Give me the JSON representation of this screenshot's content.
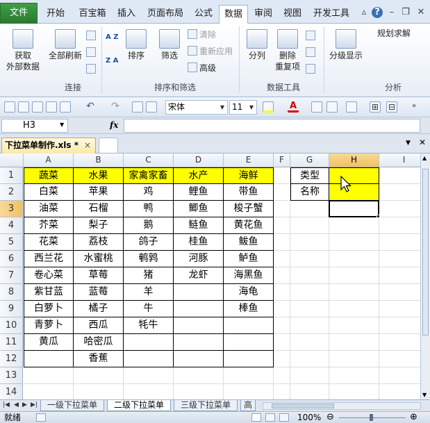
{
  "ribbon_tabs": [
    {
      "label": "文件",
      "key": "file"
    },
    {
      "label": "开始",
      "key": "home"
    },
    {
      "label": "百宝箱",
      "key": "toolbox"
    },
    {
      "label": "插入",
      "key": "insert"
    },
    {
      "label": "页面布局",
      "key": "layout"
    },
    {
      "label": "公式",
      "key": "formulas"
    },
    {
      "label": "数据",
      "key": "data"
    },
    {
      "label": "审阅",
      "key": "review"
    },
    {
      "label": "视图",
      "key": "view"
    },
    {
      "label": "开发工具",
      "key": "developer"
    }
  ],
  "ribbon": {
    "get_external": [
      "获取",
      "外部数据"
    ],
    "refresh_all": "全部刷新",
    "group_connections": "连接",
    "sort": "排序",
    "filter": "筛选",
    "clear": "清除",
    "reapply": "重新应用",
    "advanced": "高级",
    "group_sort_filter": "排序和筛选",
    "text_to_columns": "分列",
    "remove_duplicates": [
      "删除",
      "重复项"
    ],
    "group_data_tools": "数据工具",
    "outline": "分级显示",
    "solver": "规划求解",
    "group_analysis": "分析",
    "sort_az": "A Z",
    "sort_za": "Z A"
  },
  "toolbar": {
    "font_name": "宋体",
    "font_size": "11"
  },
  "formula_bar": {
    "name_box": "H3",
    "fx": "fx",
    "formula": ""
  },
  "doc_tab": {
    "title": "下拉菜单制作.xls *",
    "close": "×"
  },
  "columns": [
    "A",
    "B",
    "C",
    "D",
    "E",
    "F",
    "G",
    "H",
    "I"
  ],
  "rows": [
    "1",
    "2",
    "3",
    "4",
    "5",
    "6",
    "7",
    "8",
    "9",
    "10",
    "11",
    "12",
    "13",
    "14"
  ],
  "table": {
    "headers": [
      "蔬菜",
      "水果",
      "家禽家畜",
      "水产",
      "海鲜"
    ],
    "rows": [
      [
        "白菜",
        "苹果",
        "鸡",
        "鲤鱼",
        "带鱼"
      ],
      [
        "油菜",
        "石榴",
        "鸭",
        "鲫鱼",
        "梭子蟹"
      ],
      [
        "芥菜",
        "梨子",
        "鹅",
        "鲢鱼",
        "黄花鱼"
      ],
      [
        "花菜",
        "荔枝",
        "鸽子",
        "桂鱼",
        "鲅鱼"
      ],
      [
        "西兰花",
        "水蜜桃",
        "鹌鹑",
        "河豚",
        "鲈鱼"
      ],
      [
        "卷心菜",
        "草莓",
        "猪",
        "龙虾",
        "海黑鱼"
      ],
      [
        "紫甘蓝",
        "蓝莓",
        "羊",
        "",
        "海龟"
      ],
      [
        "白萝卜",
        "橘子",
        "牛",
        "",
        "棒鱼"
      ],
      [
        "青萝卜",
        "西瓜",
        "牦牛",
        "",
        ""
      ],
      [
        "黄瓜",
        "哈密瓜",
        "",
        "",
        ""
      ],
      [
        "",
        "香蕉",
        "",
        "",
        ""
      ]
    ]
  },
  "lookup": {
    "type_label": "类型",
    "name_label": "名称",
    "type_value": "",
    "name_value": ""
  },
  "sheet_tabs": [
    "一级下拉菜单",
    "二级下拉菜单",
    "三级下拉菜单",
    "高"
  ],
  "active_sheet_index": 1,
  "status": {
    "ready": "就绪",
    "zoom": "100%"
  },
  "colors": {
    "header_fill": "#ffff00",
    "file_tab": "#2f8a37",
    "selection_header": "#f1c15f"
  }
}
